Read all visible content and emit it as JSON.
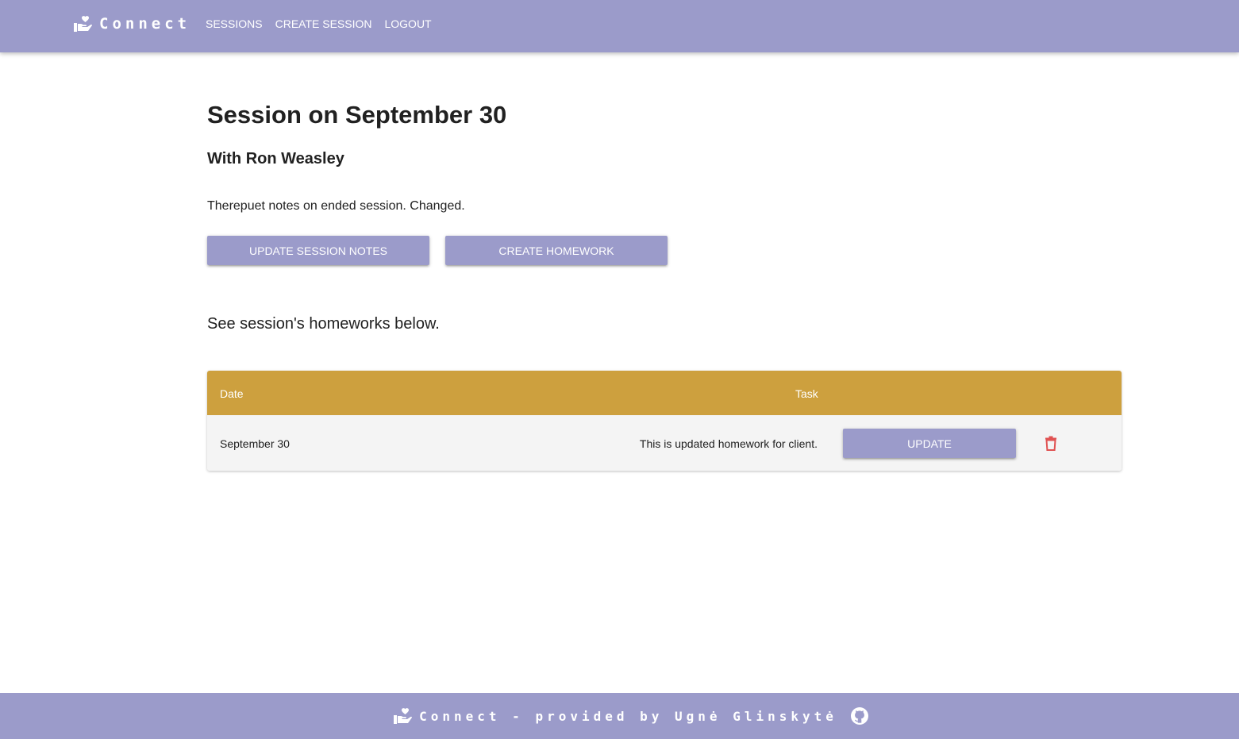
{
  "navbar": {
    "brand": "Connect",
    "links": [
      {
        "label": "SESSIONS"
      },
      {
        "label": "CREATE SESSION"
      },
      {
        "label": "LOGOUT"
      }
    ]
  },
  "session": {
    "title": "Session on September 30",
    "with": "With Ron Weasley",
    "notes": "Therepuet notes on ended session. Changed.",
    "update_notes_label": "UPDATE SESSION NOTES",
    "create_homework_label": "CREATE HOMEWORK",
    "homeworks_intro": "See session's homeworks below."
  },
  "homework_table": {
    "columns": [
      "Date",
      "Task"
    ],
    "rows": [
      {
        "date": "September 30",
        "task": "This is updated homework for client.",
        "update_label": "UPDATE"
      }
    ]
  },
  "footer": {
    "text": "Connect - provided by Ugnė Glinskytė"
  },
  "colors": {
    "primary": "#9b9bca",
    "table_header": "#cda03e",
    "delete": "#e05252"
  },
  "icons": {
    "brand": "hand-heart-icon",
    "delete": "trash-icon",
    "github": "github-icon"
  }
}
